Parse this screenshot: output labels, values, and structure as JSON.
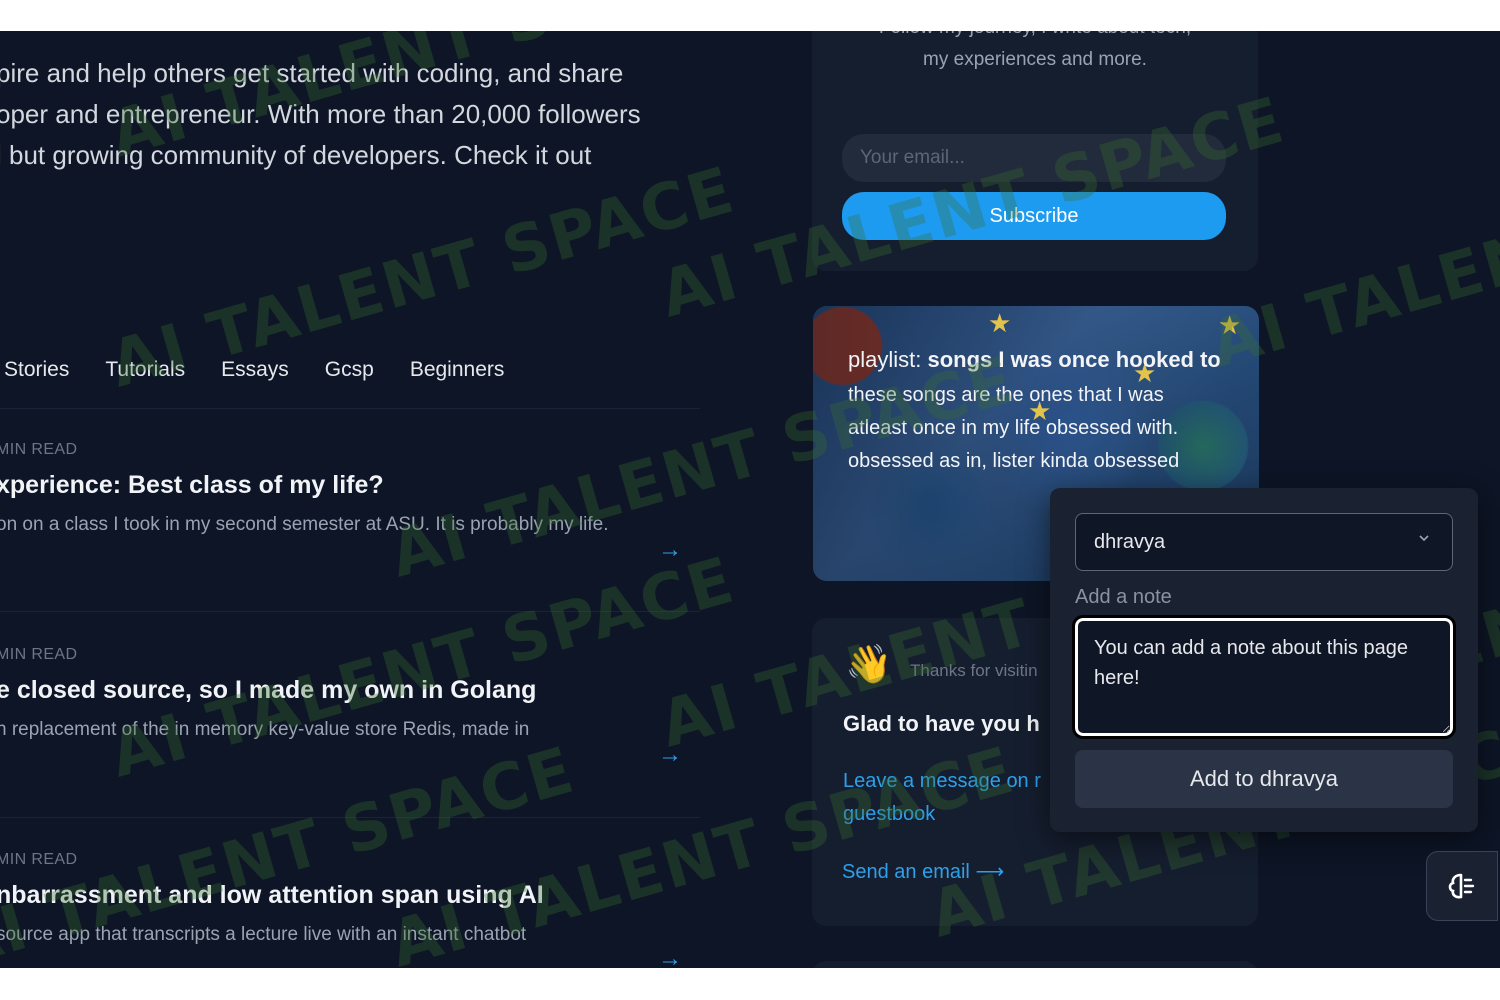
{
  "intro": {
    "lines": [
      "pire and help others get started with coding, and share",
      "oper and entrepreneur. With more than 20,000 followers",
      "l but growing community of developers. Check it out"
    ]
  },
  "tabs": [
    "Stories",
    "Tutorials",
    "Essays",
    "Gcsp",
    "Beginners"
  ],
  "articles": [
    {
      "meta": "MIN READ",
      "title": "xperience: Best class of my life?",
      "desc": "on on a class I took in my second semester at ASU. It is probably my life."
    },
    {
      "meta": "MIN READ",
      "title": "e closed source, so I made my own in Golang",
      "desc": "n replacement of the in memory key-value store Redis, made in"
    },
    {
      "meta": "MIN READ",
      "title": "nbarrassment and low attention span using AI",
      "desc": "source app that transcripts a lecture live with an instant chatbot"
    }
  ],
  "newsletter": {
    "line1": "Follow my journey, I write about tech,",
    "line2": "my experiences and more.",
    "email_placeholder": "Your email...",
    "subscribe_label": "Subscribe"
  },
  "playlist": {
    "prefix": "playlist: ",
    "title_bold": "songs I was once hooked to",
    "desc": "these songs are the ones that I was atleast once in my life obsessed with. obsessed as in, lister kinda obsessed"
  },
  "guestbook": {
    "wave": "👋",
    "thanks": "Thanks for visitin",
    "glad": "Glad to have you h",
    "message_link_1": "Leave a message on r",
    "message_link_2": "guestbook",
    "email_link": "Send an email"
  },
  "popup": {
    "selected": "dhravya",
    "note_label": "Add a note",
    "note_value": "You can add a note about this page here!",
    "add_button": "Add to dhravya"
  },
  "watermark": "AI TALENT SPACE",
  "colors": {
    "background": "#0d1526",
    "card": "#151e2f",
    "accent": "#1d9bf0",
    "link": "#2ea0ea"
  }
}
